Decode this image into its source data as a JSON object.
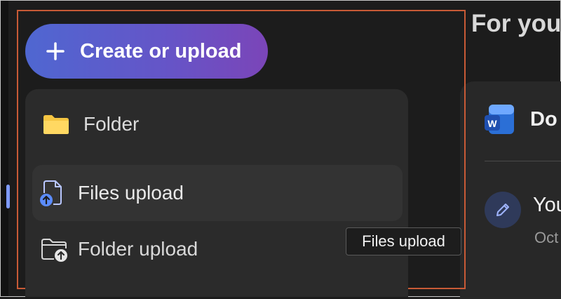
{
  "create_button": {
    "label": "Create or upload",
    "icon": "plus-icon"
  },
  "menu": {
    "items": [
      {
        "label": "Folder",
        "icon": "folder-icon"
      },
      {
        "label": "Files upload",
        "icon": "file-upload-icon"
      },
      {
        "label": "Folder upload",
        "icon": "folder-upload-icon"
      }
    ]
  },
  "tooltip": {
    "text": "Files upload"
  },
  "right_panel": {
    "title": "For you",
    "card": {
      "doc_title": "Do",
      "activity_text": "You",
      "activity_date": "Oct"
    }
  },
  "colors": {
    "accent_gradient_start": "#4f67d1",
    "accent_gradient_end": "#7b45b8",
    "highlight_border": "#c85a36",
    "menu_bg": "#2b2b2b",
    "page_bg": "#1c1c1c"
  }
}
